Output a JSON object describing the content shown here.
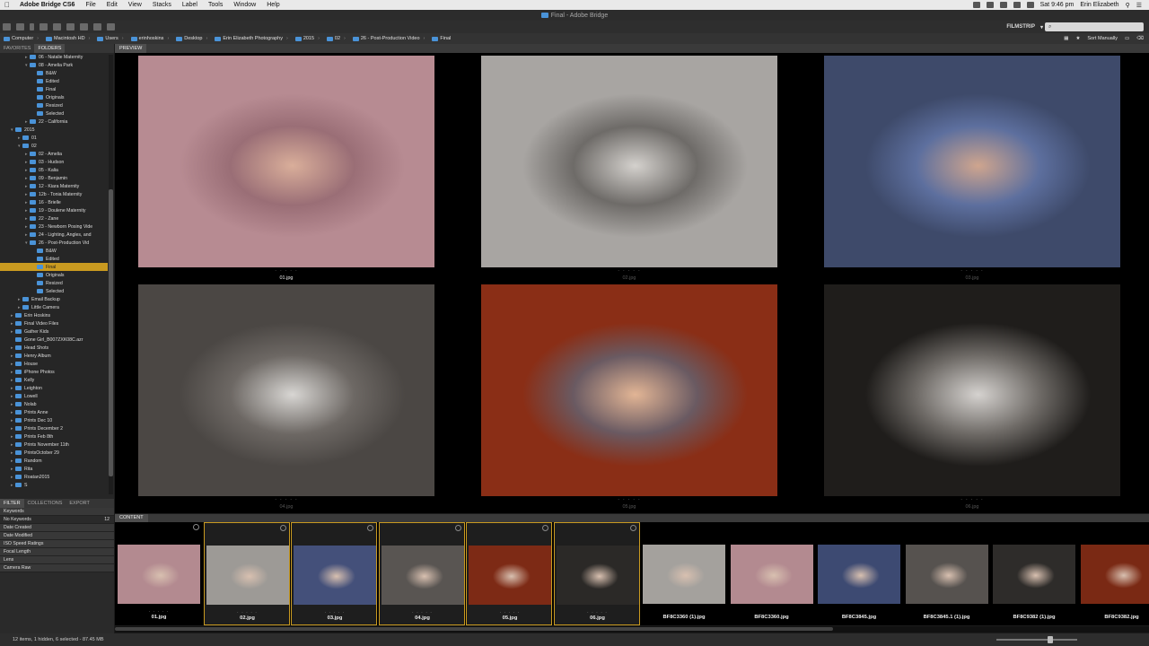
{
  "menubar": {
    "apple": "",
    "app_name": "Adobe Bridge CS6",
    "items": [
      "File",
      "Edit",
      "View",
      "Stacks",
      "Label",
      "Tools",
      "Window",
      "Help"
    ],
    "clock": "Sat 9:46 pm",
    "user": "Erin Elizabeth"
  },
  "window": {
    "title": "Final - Adobe Bridge"
  },
  "toolbar": {
    "workspace": "FILMSTRIP",
    "search_placeholder": "⌕"
  },
  "pathbar": {
    "crumbs": [
      "Computer",
      "Macintosh HD",
      "Users",
      "erinhoskins",
      "Desktop",
      "Erin Elizabeth Photography",
      "2015",
      "02",
      "26 - Post-Production Video",
      "Final"
    ],
    "sort_label": "Sort Manually"
  },
  "left_panel": {
    "tabs": [
      "FAVORITES",
      "FOLDERS"
    ],
    "active_tab": "FOLDERS",
    "tree": [
      {
        "label": "06 - Natalie Maternity",
        "level": 3,
        "twisty": "▸"
      },
      {
        "label": "08 - Amelia Park",
        "level": 3,
        "twisty": "▾"
      },
      {
        "label": "B&W",
        "level": 4,
        "twisty": ""
      },
      {
        "label": "Edited",
        "level": 4,
        "twisty": ""
      },
      {
        "label": "Final",
        "level": 4,
        "twisty": ""
      },
      {
        "label": "Originals",
        "level": 4,
        "twisty": ""
      },
      {
        "label": "Resized",
        "level": 4,
        "twisty": ""
      },
      {
        "label": "Selected",
        "level": 4,
        "twisty": ""
      },
      {
        "label": "22 - California",
        "level": 3,
        "twisty": "▸"
      },
      {
        "label": "2015",
        "level": 1,
        "twisty": "▾"
      },
      {
        "label": "01",
        "level": 2,
        "twisty": "▸"
      },
      {
        "label": "02",
        "level": 2,
        "twisty": "▾"
      },
      {
        "label": "02 - Amelia",
        "level": 3,
        "twisty": "▸"
      },
      {
        "label": "03 - Hudson",
        "level": 3,
        "twisty": "▸"
      },
      {
        "label": "05 - Kalia",
        "level": 3,
        "twisty": "▸"
      },
      {
        "label": "09 - Benjamin",
        "level": 3,
        "twisty": "▸"
      },
      {
        "label": "12 - Kiara Maternity",
        "level": 3,
        "twisty": "▸"
      },
      {
        "label": "12b - Tonia Maternity",
        "level": 3,
        "twisty": "▸"
      },
      {
        "label": "16 - Brielle",
        "level": 3,
        "twisty": "▸"
      },
      {
        "label": "19 - Doulene Maternity",
        "level": 3,
        "twisty": "▸"
      },
      {
        "label": "22 - Zane",
        "level": 3,
        "twisty": "▸"
      },
      {
        "label": "23 - Newborn Posing Vide",
        "level": 3,
        "twisty": "▸"
      },
      {
        "label": "24 - Lighting, Angles, and",
        "level": 3,
        "twisty": "▸"
      },
      {
        "label": "26 - Post-Production Vid",
        "level": 3,
        "twisty": "▾"
      },
      {
        "label": "B&W",
        "level": 4,
        "twisty": ""
      },
      {
        "label": "Edited",
        "level": 4,
        "twisty": ""
      },
      {
        "label": "Final",
        "level": 4,
        "twisty": "",
        "selected": true
      },
      {
        "label": "Originals",
        "level": 4,
        "twisty": ""
      },
      {
        "label": "Resized",
        "level": 4,
        "twisty": ""
      },
      {
        "label": "Selected",
        "level": 4,
        "twisty": ""
      },
      {
        "label": "Email Backup",
        "level": 2,
        "twisty": "▸"
      },
      {
        "label": "Little Camera",
        "level": 2,
        "twisty": "▸"
      },
      {
        "label": "Erin Hoskins",
        "level": 1,
        "twisty": "▸"
      },
      {
        "label": "Final Video Files",
        "level": 1,
        "twisty": "▸"
      },
      {
        "label": "Gather Kids",
        "level": 1,
        "twisty": "▸"
      },
      {
        "label": "Gone Girl_B007ZXK08C.azr",
        "level": 1,
        "twisty": ""
      },
      {
        "label": "Head Shots",
        "level": 1,
        "twisty": "▸"
      },
      {
        "label": "Henry Album",
        "level": 1,
        "twisty": "▸"
      },
      {
        "label": "House",
        "level": 1,
        "twisty": "▸"
      },
      {
        "label": "iPhone Photos",
        "level": 1,
        "twisty": "▸"
      },
      {
        "label": "Kelly",
        "level": 1,
        "twisty": "▸"
      },
      {
        "label": "Leighton",
        "level": 1,
        "twisty": "▸"
      },
      {
        "label": "Lowell",
        "level": 1,
        "twisty": "▸"
      },
      {
        "label": "Nolab",
        "level": 1,
        "twisty": "▸"
      },
      {
        "label": "Prints Anne",
        "level": 1,
        "twisty": "▸"
      },
      {
        "label": "Prints Dec 10",
        "level": 1,
        "twisty": "▸"
      },
      {
        "label": "Prints December 2",
        "level": 1,
        "twisty": "▸"
      },
      {
        "label": "Prints Feb 8th",
        "level": 1,
        "twisty": "▸"
      },
      {
        "label": "Prints November 11th",
        "level": 1,
        "twisty": "▸"
      },
      {
        "label": "PrintsOctober 29",
        "level": 1,
        "twisty": "▸"
      },
      {
        "label": "Random",
        "level": 1,
        "twisty": "▸"
      },
      {
        "label": "Rita",
        "level": 1,
        "twisty": "▸"
      },
      {
        "label": "Roatan2015",
        "level": 1,
        "twisty": "▸"
      },
      {
        "label": "S",
        "level": 1,
        "twisty": "▸"
      }
    ]
  },
  "filter_panel": {
    "tabs": [
      "FILTER",
      "COLLECTIONS",
      "EXPORT"
    ],
    "active_tab": "FILTER",
    "rows": [
      {
        "label": "Keywords",
        "count": "",
        "header": true
      },
      {
        "label": "No Keywords",
        "count": "12",
        "header": false
      },
      {
        "label": "Date Created",
        "count": "",
        "header": true
      },
      {
        "label": "Date Modified",
        "count": "",
        "header": true
      },
      {
        "label": "ISO Speed Ratings",
        "count": "",
        "header": true
      },
      {
        "label": "Focal Length",
        "count": "",
        "header": true
      },
      {
        "label": "Lens",
        "count": "",
        "header": true
      },
      {
        "label": "Camera Raw",
        "count": "",
        "header": true
      }
    ]
  },
  "preview": {
    "tab": "PREVIEW",
    "dots": "· · · · ·",
    "images": [
      {
        "label": "01.jpg",
        "dim": false,
        "colors": [
          "#b78b92",
          "#9a6e76",
          "#d9ae9a"
        ]
      },
      {
        "label": "02.jpg",
        "dim": true,
        "colors": [
          "#a8a5a2",
          "#6e6b68",
          "#d4d1cd"
        ]
      },
      {
        "label": "03.jpg",
        "dim": true,
        "colors": [
          "#3e4a6a",
          "#5d6f9e",
          "#cfa58e"
        ]
      },
      {
        "label": "04.jpg",
        "dim": true,
        "colors": [
          "#4b4744",
          "#6d6864",
          "#d8d6d3"
        ]
      },
      {
        "label": "05.jpg",
        "dim": true,
        "colors": [
          "#8a2e16",
          "#6a5a62",
          "#e2b595"
        ]
      },
      {
        "label": "06.jpg",
        "dim": true,
        "colors": [
          "#1f1d1b",
          "#6e6a66",
          "#d5d2cf"
        ]
      }
    ]
  },
  "content": {
    "tab": "CONTENT",
    "dots": "· · · · ·",
    "items": [
      {
        "label": "01.jpg",
        "selected": false,
        "color": "#b38a90"
      },
      {
        "label": "02.jpg",
        "selected": true,
        "color": "#9d9a96"
      },
      {
        "label": "03.jpg",
        "selected": true,
        "color": "#44507a"
      },
      {
        "label": "04.jpg",
        "selected": true,
        "color": "#595552"
      },
      {
        "label": "05.jpg",
        "selected": true,
        "color": "#7d2a15"
      },
      {
        "label": "06.jpg",
        "selected": true,
        "color": "#2b2927"
      },
      {
        "label": "BF8C3360 (1).jpg",
        "selected": false,
        "color": "#a4a19d"
      },
      {
        "label": "BF8C3360.jpg",
        "selected": false,
        "color": "#b38a90"
      },
      {
        "label": "BF8C3845.jpg",
        "selected": false,
        "color": "#3d4a72"
      },
      {
        "label": "BF8C3845.1 (1).jpg",
        "selected": false,
        "color": "#56524f"
      },
      {
        "label": "BF8C9382 (1).jpg",
        "selected": false,
        "color": "#2e2c2a"
      },
      {
        "label": "BF8C9382.jpg",
        "selected": false,
        "color": "#7a2914"
      }
    ]
  },
  "status": {
    "text": "12 items, 1 hidden, 6 selected - 87.45 MB",
    "thumb_size": 0.67
  }
}
